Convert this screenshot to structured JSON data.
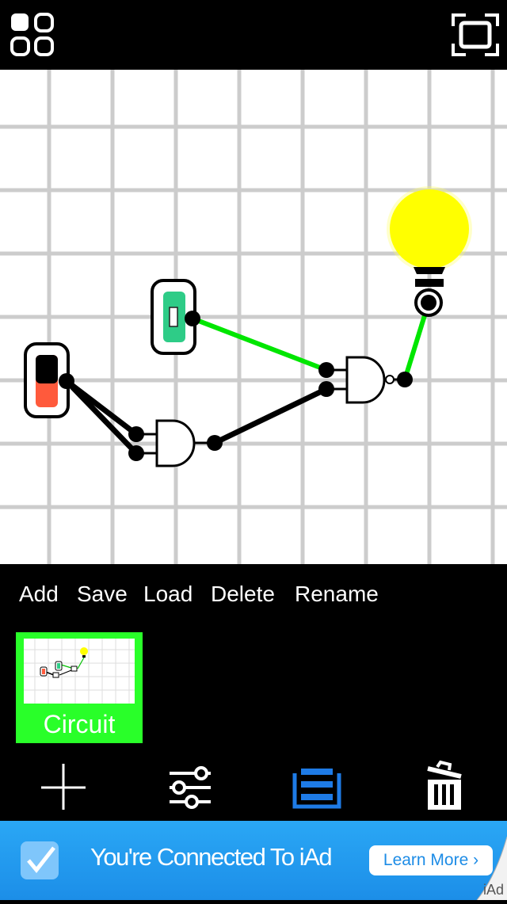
{
  "menu": {
    "add": "Add",
    "save": "Save",
    "load": "Load",
    "delete": "Delete",
    "rename": "Rename"
  },
  "saves": [
    {
      "label": "Circuit"
    }
  ],
  "toolbar": {
    "icons": [
      "plus-icon",
      "sliders-icon",
      "stack-icon",
      "trash-icon"
    ],
    "active": "stack-icon",
    "active_color": "#1e7be6"
  },
  "ad": {
    "text": "You're Connected To iAd",
    "button": "Learn More ›",
    "tag": "iAd"
  },
  "colors": {
    "wire_on": "#00e600",
    "wire_off": "#000000",
    "bulb_on": "#ffff00",
    "switch_on": "#2ecc87",
    "switch_off": "#ff5a3c",
    "grid": "#cccccc",
    "save_highlight": "#29ff29"
  }
}
